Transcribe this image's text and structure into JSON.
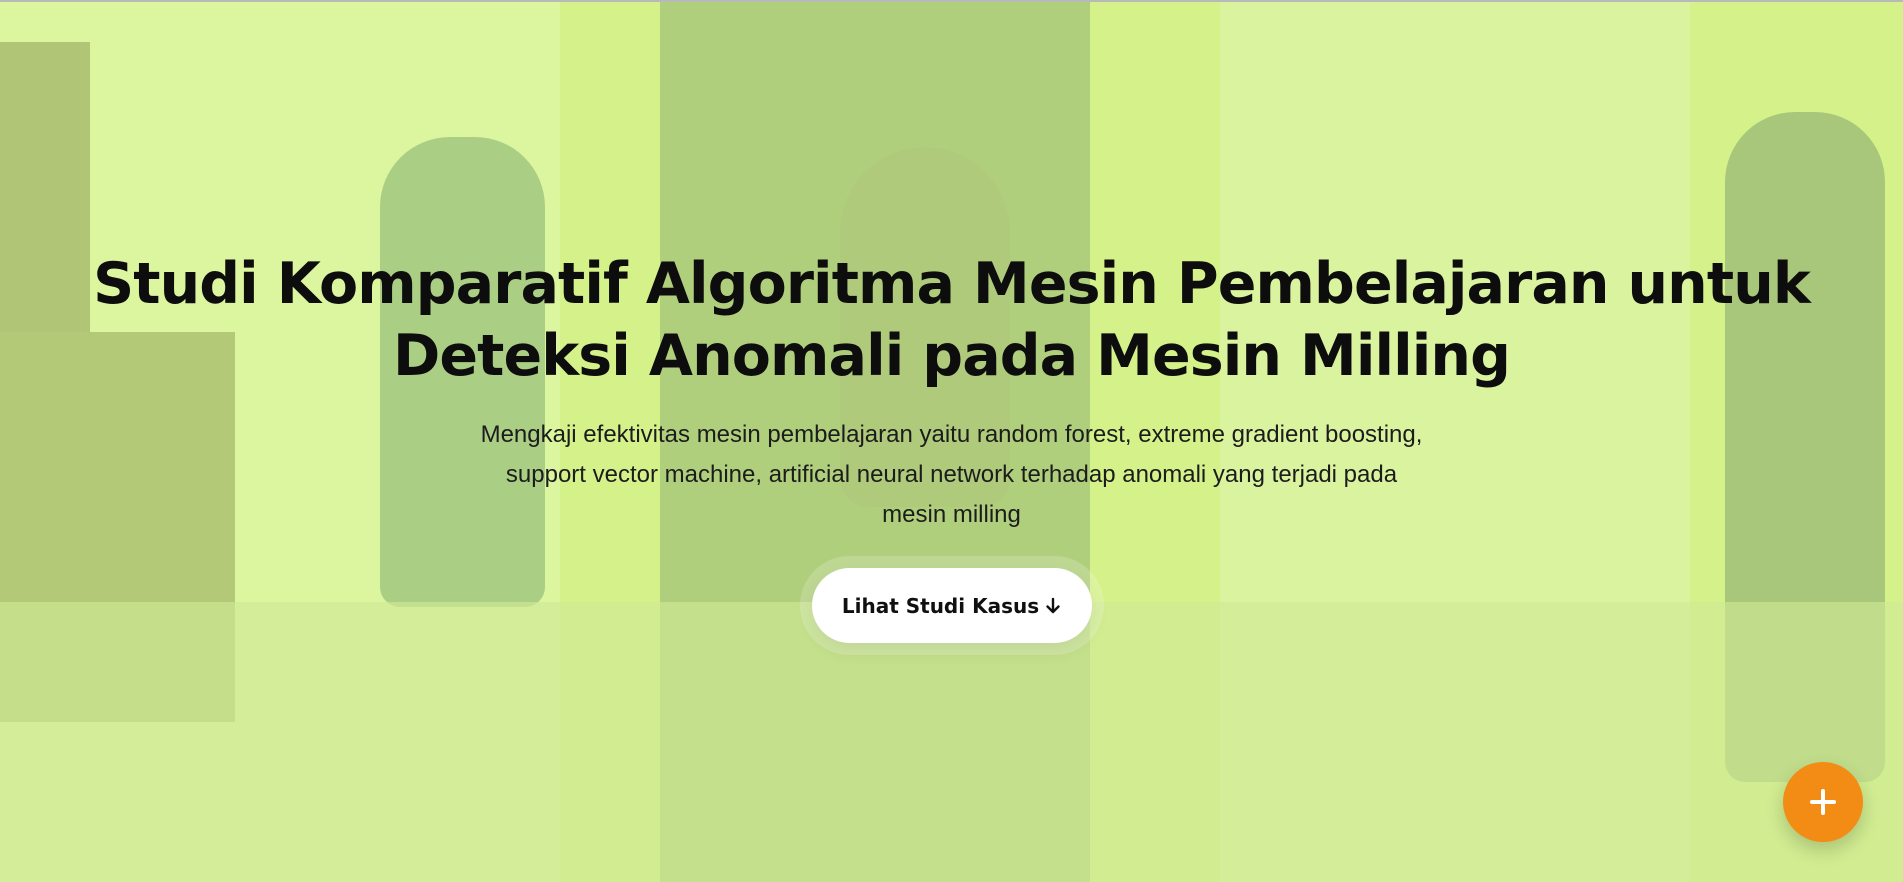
{
  "hero": {
    "title": "Studi Komparatif Algoritma Mesin Pembelajaran untuk Deteksi Anomali pada Mesin Milling",
    "subtitle": "Mengkaji efektivitas mesin pembelajaran yaitu random forest, extreme gradient boosting, support vector machine, artificial neural network terhadap anomali yang terjadi pada mesin milling",
    "cta_label": "Lihat Studi Kasus",
    "cta_icon": "arrow-down-icon",
    "background_image": "factory-workshop-milling-machines",
    "overlay_color": "#d5f488"
  },
  "floating_action": {
    "icon": "plus-icon",
    "color": "#f28c14"
  }
}
